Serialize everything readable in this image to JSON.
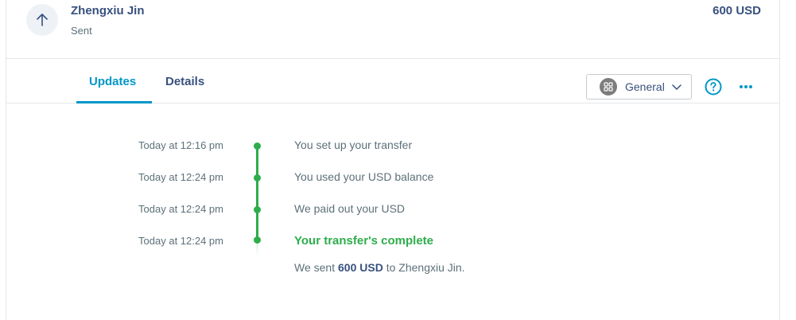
{
  "transfer": {
    "recipient": "Zhengxiu Jin",
    "status": "Sent",
    "amount": "600 USD"
  },
  "tabs": [
    {
      "label": "Updates",
      "active": true
    },
    {
      "label": "Details",
      "active": false
    }
  ],
  "category_dropdown": {
    "selected": "General",
    "icon": "grid-icon"
  },
  "actions": {
    "help_icon": "help-circle-icon",
    "more_icon": "more-dots-icon"
  },
  "timeline": [
    {
      "time": "Today at 12:16 pm",
      "event": "You set up your transfer"
    },
    {
      "time": "Today at 12:24 pm",
      "event": "You used your USD balance"
    },
    {
      "time": "Today at 12:24 pm",
      "event": "We paid out your USD"
    },
    {
      "time": "Today at 12:24 pm",
      "event": "Your transfer's complete"
    }
  ],
  "completion_note": {
    "prefix": "We sent ",
    "amount": "600 USD",
    "middle": " to ",
    "recipient": "Zhengxiu Jin",
    "suffix": "."
  },
  "colors": {
    "accent": "#0097c7",
    "success": "#2ead4b",
    "text_primary": "#37517e",
    "text_secondary": "#5d7079"
  }
}
